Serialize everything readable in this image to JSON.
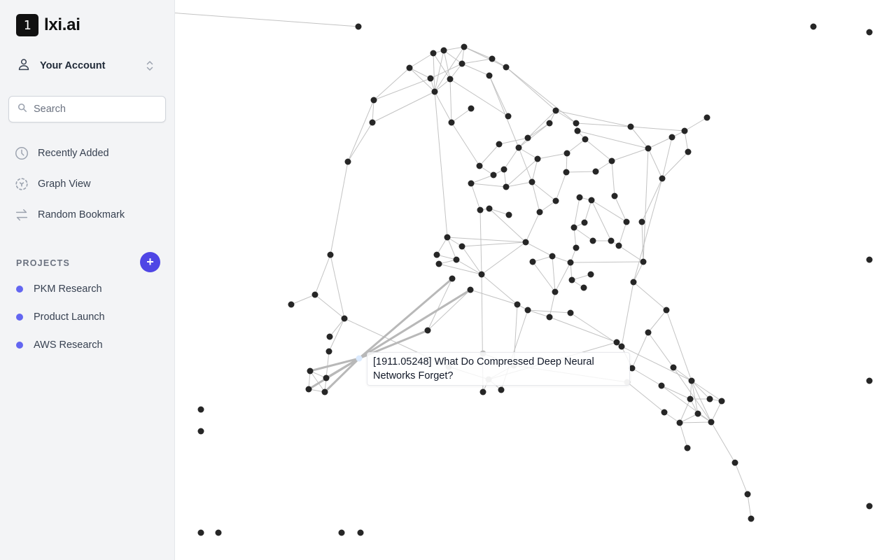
{
  "app": {
    "logo_mark": "1",
    "name": "lxi.ai"
  },
  "account": {
    "label": "Your Account",
    "icon": "user-icon",
    "chevron": "chevron-up-down-icon"
  },
  "search": {
    "placeholder": "Search",
    "value": "",
    "icon": "search-icon"
  },
  "nav": [
    {
      "label": "Recently Added",
      "icon": "clock-icon"
    },
    {
      "label": "Graph View",
      "icon": "graph-view-icon"
    },
    {
      "label": "Random Bookmark",
      "icon": "arrows-swap-icon"
    }
  ],
  "projects": {
    "header": "PROJECTS",
    "add_label": "+",
    "items": [
      {
        "label": "PKM Research",
        "color": "#6366f1"
      },
      {
        "label": "Product Launch",
        "color": "#6366f1"
      },
      {
        "label": "AWS Research",
        "color": "#6366f1"
      }
    ]
  },
  "colors": {
    "accent": "#4f46e5",
    "node": "#262626",
    "edge": "#bdbdbd",
    "hover_node": "#dbeafe",
    "faded_node": "#bfbfbf"
  },
  "graph": {
    "hovered_node_label": "[1911.05248] What Do Compressed Deep Neural Networks Forget?"
  }
}
